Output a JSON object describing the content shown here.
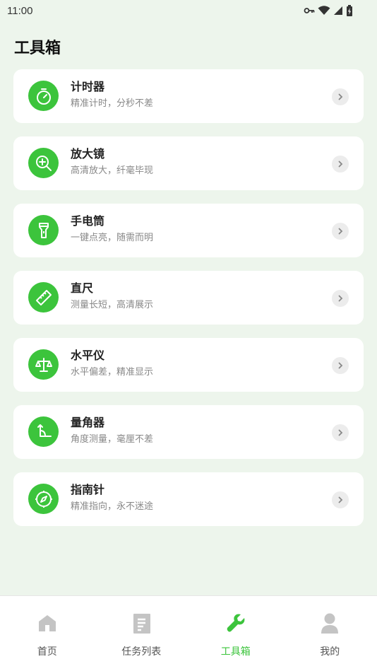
{
  "status_bar": {
    "time": "11:00"
  },
  "page_title": "工具箱",
  "tools": [
    {
      "name": "计时器",
      "desc": "精准计时，分秒不差",
      "icon": "stopwatch-icon"
    },
    {
      "name": "放大镜",
      "desc": "高清放大，纤毫毕现",
      "icon": "magnifier-icon"
    },
    {
      "name": "手电筒",
      "desc": "一键点亮，随需而明",
      "icon": "flashlight-icon"
    },
    {
      "name": "直尺",
      "desc": "测量长短，高清展示",
      "icon": "ruler-icon"
    },
    {
      "name": "水平仪",
      "desc": "水平偏差，精准显示",
      "icon": "balance-icon"
    },
    {
      "name": "量角器",
      "desc": "角度测量，毫厘不差",
      "icon": "protractor-icon"
    },
    {
      "name": "指南针",
      "desc": "精准指向，永不迷途",
      "icon": "compass-icon"
    }
  ],
  "bottom_nav": [
    {
      "label": "首页",
      "icon": "home-icon",
      "active": false
    },
    {
      "label": "任务列表",
      "icon": "document-icon",
      "active": false
    },
    {
      "label": "工具箱",
      "icon": "wrench-icon",
      "active": true
    },
    {
      "label": "我的",
      "icon": "user-icon",
      "active": false
    }
  ],
  "colors": {
    "accent": "#3cc43c",
    "background": "#edf5ec",
    "inactive_icon": "#c4c4c4"
  }
}
